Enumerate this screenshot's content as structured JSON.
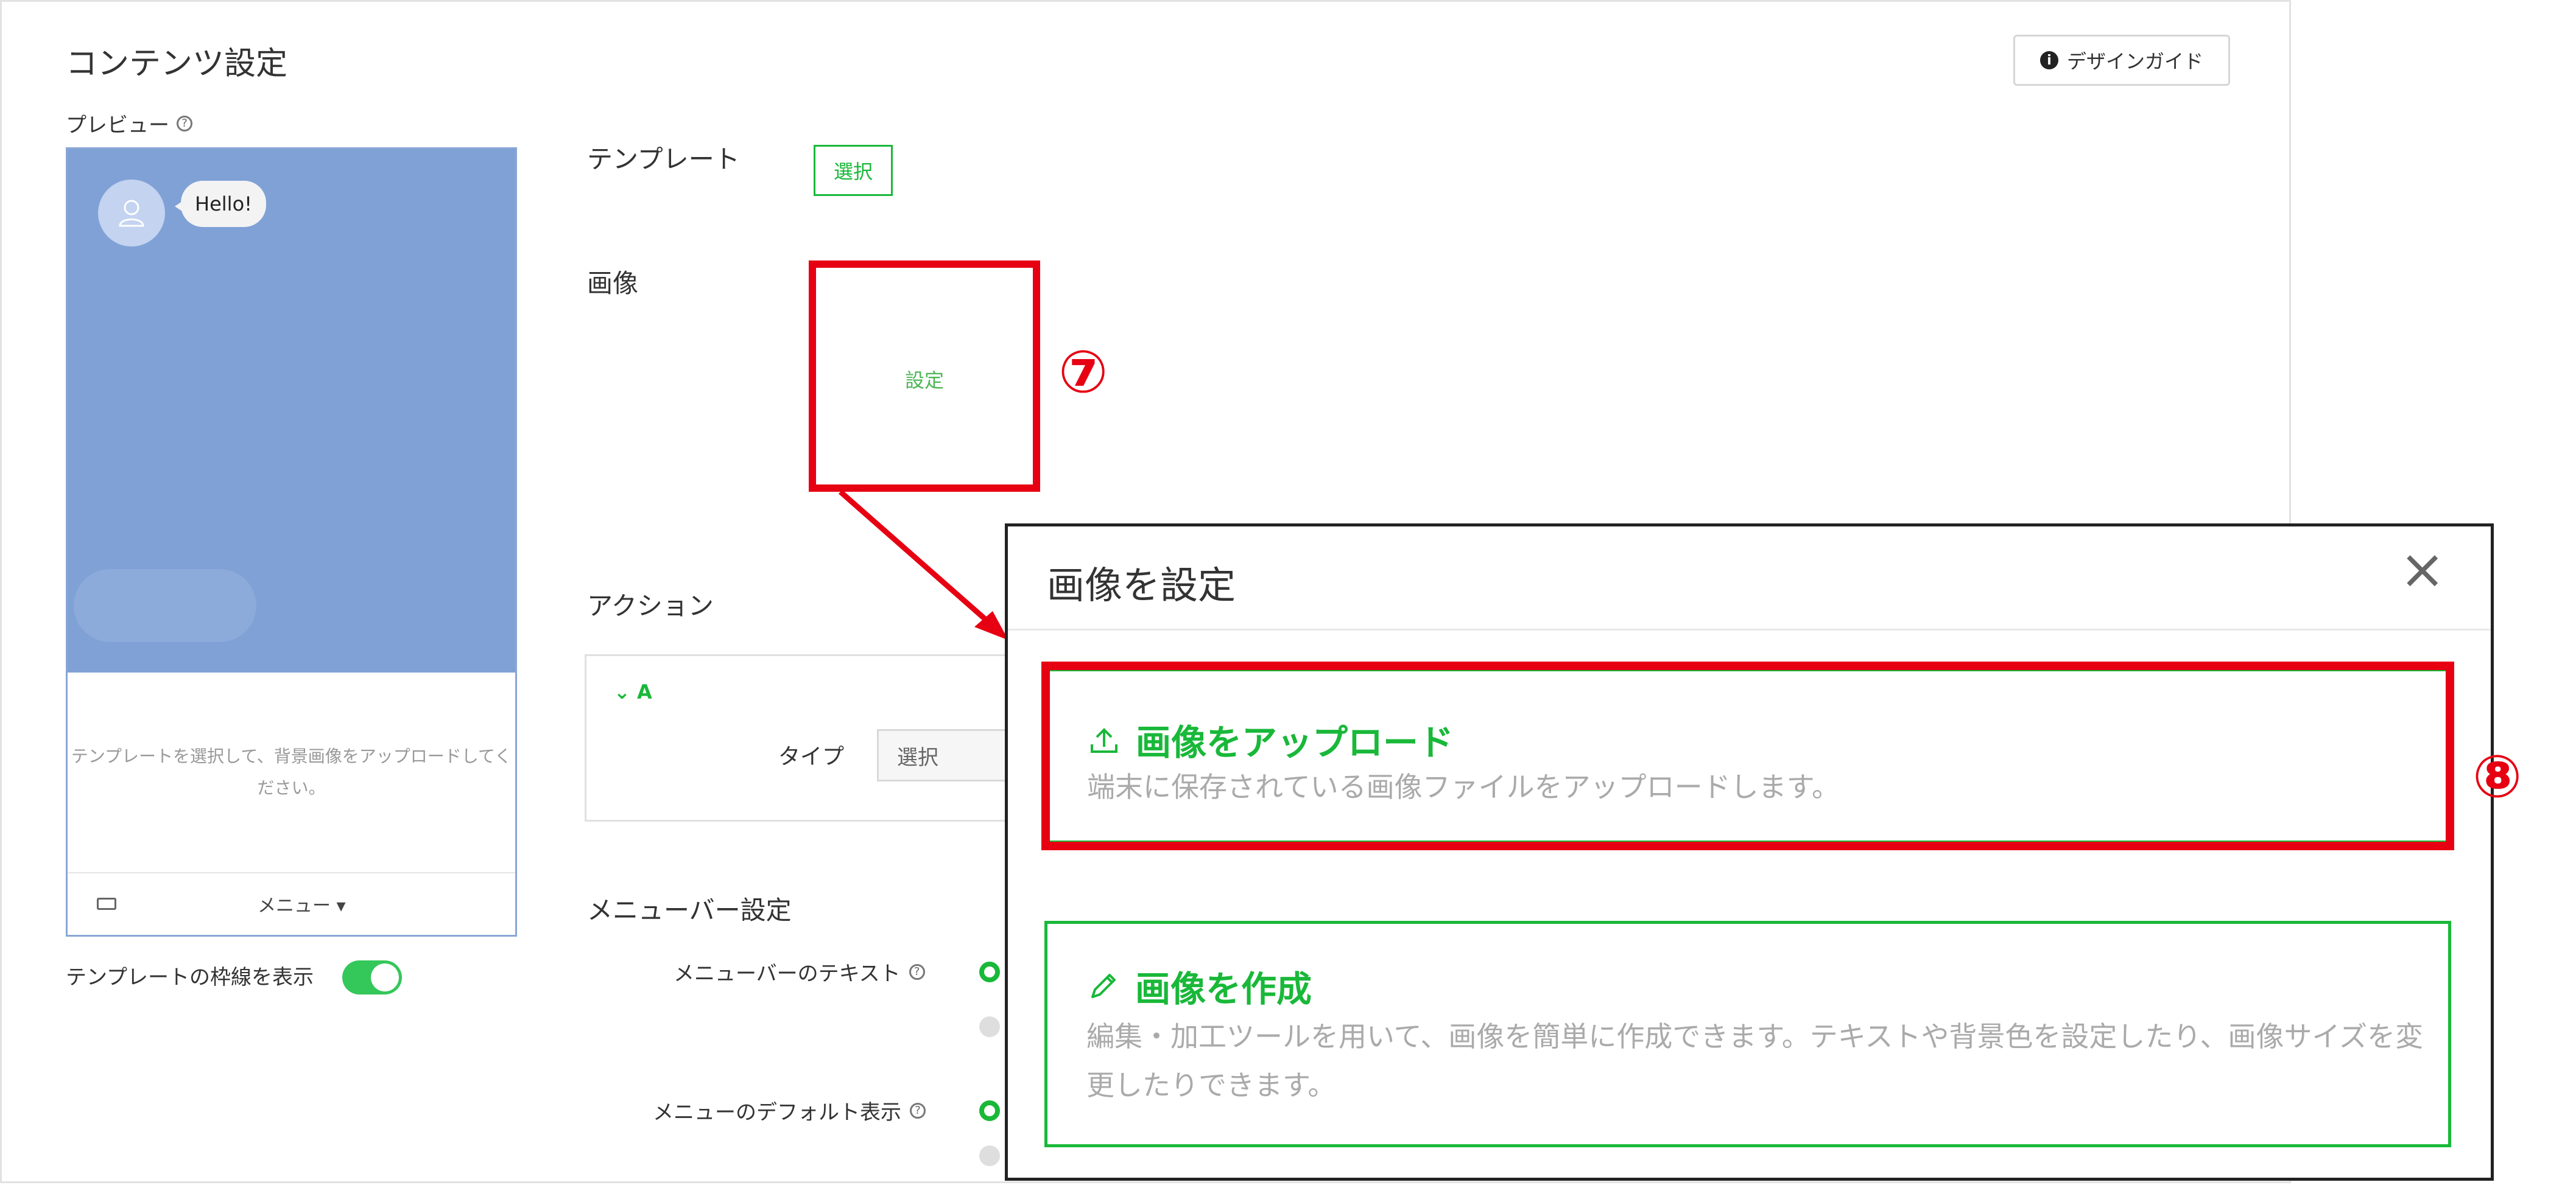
{
  "header": {
    "title": "コンテンツ設定",
    "design_guide_label": "デザインガイド"
  },
  "preview": {
    "label": "プレビュー",
    "bubble_text": "Hello!",
    "hint": "テンプレートを選択して、背景画像をアップロードしてください。",
    "menu_label": "メニュー ▾",
    "border_toggle_label": "テンプレートの枠線を表示",
    "border_toggle_on": true
  },
  "form": {
    "template_label": "テンプレート",
    "template_button": "選択",
    "image_label": "画像",
    "image_set_link": "設定",
    "action_label": "アクション",
    "action_item": "A",
    "type_label": "タイプ",
    "type_select_value": "選択",
    "menubar_label": "メニューバー設定",
    "menubar_text_label": "メニューバーのテキスト",
    "menu_default_label": "メニューのデフォルト表示"
  },
  "annotations": {
    "step7": "⑦",
    "step8": "⑧",
    "accent_red": "#e60012"
  },
  "modal": {
    "title": "画像を設定",
    "close_icon": "×",
    "options": [
      {
        "title": "画像をアップロード",
        "desc": "端末に保存されている画像ファイルをアップロードします。",
        "icon": "upload-icon"
      },
      {
        "title": "画像を作成",
        "desc": "編集・加工ツールを用いて、画像を簡単に作成できます。テキストや背景色を設定したり、画像サイズを変更したりできます。",
        "icon": "pencil-icon"
      }
    ]
  },
  "colors": {
    "brand_green": "#19b839",
    "preview_blue": "#7fa1d6"
  }
}
